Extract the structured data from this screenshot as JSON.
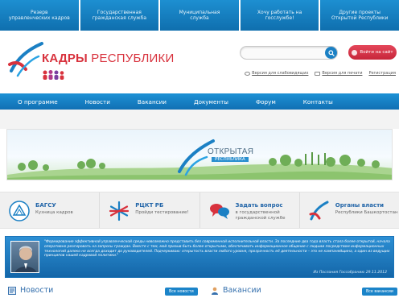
{
  "top_links": [
    {
      "line1": "Резерв",
      "line2": "управленческих кадров"
    },
    {
      "line1": "Государственная",
      "line2": "гражданская служба"
    },
    {
      "line1": "Муниципальная",
      "line2": "служба"
    },
    {
      "line1": "Хочу работать на",
      "line2": "госслужбе!"
    },
    {
      "line1": "Другие проекты",
      "line2": "Открытой Республики"
    }
  ],
  "header": {
    "logo_bold": "КАДРЫ",
    "logo_thin": "РЕСПУБЛИКИ",
    "search_placeholder": "",
    "login_label": "Войти на сайт",
    "links": [
      "Версия для слабовидящих",
      "Версия для печати",
      "Регистрация"
    ]
  },
  "nav": [
    "О программе",
    "Новости",
    "Вакансии",
    "Документы",
    "Форум",
    "Контакты"
  ],
  "banner": {
    "title": "ОТКРЫТАЯ",
    "subtitle": "РЕСПУБЛИКА"
  },
  "quick_links": [
    {
      "title": "БАГСУ",
      "sub1": "Кузница кадров",
      "sub2": "",
      "icon": "bagsu-emblem-icon"
    },
    {
      "title": "РЦКТ РБ",
      "sub1": "Пройди тестирование!",
      "sub2": "",
      "icon": "rckt-snowflake-icon"
    },
    {
      "title": "Задать вопрос",
      "sub1": "в государственной",
      "sub2": "гражданской службе",
      "icon": "chat-bubbles-icon"
    },
    {
      "title": "Органы власти",
      "sub1": "Республики Башкортостан",
      "sub2": "",
      "icon": "authorities-swoosh-icon"
    }
  ],
  "quote": {
    "text": "\"Формирование эффективной управленческой среды невозможно представить без современной исполнительной власти. За последние два года власть стала более открытой, начала оперативно реагировать на запросы граждан. Вместе с тем, мой призыв быть более открытыми, обеспечивать информационное общение с людьми посредством информационных технологий далеко не всегда доходит до руководителей. Подчеркиваю: открытость власти любого уровня, прозрачность её деятельности – это не кампанейщина, а один из ведущих принципов нашей кадровой политики.\"",
    "cite": "Из Послания Госсобранию 29.11.2012"
  },
  "sections": {
    "news_title": "Новости",
    "news_button": "Все новости",
    "jobs_title": "Вакансии",
    "jobs_button": "Все вакансии"
  },
  "colors": {
    "brand_blue": "#1b80c4",
    "brand_red": "#d8323d"
  }
}
